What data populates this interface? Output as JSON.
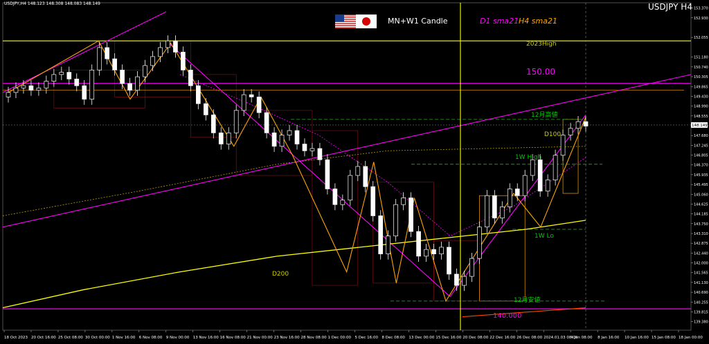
{
  "window": {
    "symbol_header": "USDJPY,H4  148.123 148.308 148.083 148.149",
    "title": "USDJPY H4",
    "indicator_label": "MN+W1 Candle",
    "sma_label_1": "D1 sma21",
    "sma_label_2": "H4 sma21"
  },
  "colors": {
    "background": "#000000",
    "bull_candle": "#ffffff",
    "bear_candle": "#ffffff",
    "zigzag": "#ffa500",
    "trendline": "#ff00ff",
    "sma_200": "#ffff00",
    "level_line": "#ffff00",
    "price_line": "#cc8400",
    "green_label": "#00cc00",
    "axis_text": "#ffffff"
  },
  "icons": {
    "flag_left": "us-flag-icon",
    "flag_right": "japan-flag-icon"
  },
  "annotations": {
    "high_2023": "2023High",
    "level_150": "150.00",
    "dec_high": "12月高値",
    "d100": "D100",
    "w1_high": "1W High",
    "w1_low": "1W Lo",
    "d200": "D200",
    "dec_low": "12月安値",
    "level_140": "140.000"
  },
  "chart_data": {
    "type": "candlestick",
    "symbol": "USDJPY",
    "timeframe": "H4",
    "ylim": [
      139.0,
      153.6
    ],
    "y_ticks": [
      "153.370",
      "152.930",
      "152.055",
      "151.180",
      "150.740",
      "150.305",
      "149.865",
      "149.430",
      "148.990",
      "148.555",
      "148.120",
      "147.680",
      "147.245",
      "146.805",
      "146.370",
      "145.935",
      "145.495",
      "145.060",
      "144.625",
      "144.185",
      "143.750",
      "143.310",
      "142.875",
      "142.440",
      "142.000",
      "141.565",
      "141.130",
      "140.690",
      "140.255",
      "139.815",
      "139.380"
    ],
    "x_ticks": [
      "18 Oct 2023",
      "20 Oct 16:00",
      "25 Oct 08:00",
      "30 Oct 00:00",
      "1 Nov 16:00",
      "6 Nov 08:00",
      "9 Nov 00:00",
      "13 Nov 16:00",
      "16 Nov 08:00",
      "21 Nov 00:00",
      "23 Nov 16:00",
      "28 Nov 08:00",
      "1 Dec 00:00",
      "5 Dec 16:00",
      "8 Dec 08:00",
      "13 Dec 00:00",
      "15 Dec 16:00",
      "20 Dec 08:00",
      "22 Dec 16:00",
      "26 Dec 08:00",
      "2024.01.03 08:00",
      "4 Jan 08:00",
      "8 Jan 16:00",
      "10 Jan 16:00",
      "15 Jan 08:00",
      "18 Jan 00:00"
    ],
    "current_price": 148.149,
    "horizontal_levels": [
      {
        "label": "2023High",
        "value": 151.9
      },
      {
        "label": "150.00",
        "value": 150.0
      },
      {
        "label": "12月高値",
        "value": 148.4
      },
      {
        "label": "1W High",
        "value": 146.4
      },
      {
        "label": "1W Lo",
        "value": 143.5
      },
      {
        "label": "12月安値",
        "value": 140.3
      },
      {
        "label": "140.000",
        "value": 139.95
      }
    ],
    "close_series": [
      149.6,
      149.8,
      149.9,
      149.7,
      149.8,
      150.1,
      150.4,
      150.5,
      150.2,
      149.9,
      149.3,
      150.6,
      151.6,
      151.1,
      150.6,
      150.0,
      149.7,
      150.3,
      150.8,
      151.2,
      151.6,
      151.9,
      151.4,
      150.6,
      149.9,
      149.1,
      148.6,
      147.8,
      147.3,
      147.8,
      148.8,
      149.5,
      149.4,
      148.7,
      147.8,
      147.2,
      147.7,
      147.9,
      147.3,
      147.0,
      147.1,
      146.6,
      145.3,
      144.6,
      144.8,
      145.9,
      146.3,
      145.4,
      144.1,
      142.4,
      143.2,
      144.6,
      144.9,
      143.4,
      142.3,
      142.6,
      142.4,
      142.7,
      141.5,
      141.0,
      141.4,
      142.2,
      143.6,
      145.0,
      144.0,
      144.5,
      145.3,
      145.0,
      145.9,
      146.6,
      145.2,
      145.7,
      146.8,
      147.7,
      148.0,
      148.3,
      148.1
    ]
  }
}
